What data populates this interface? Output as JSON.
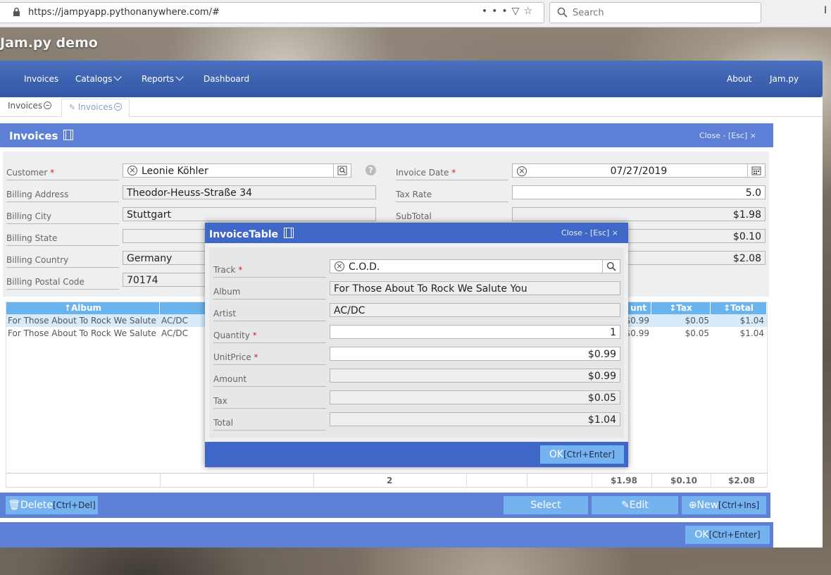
{
  "browser": {
    "url": "https://jampyapp.pythonanywhere.com/#",
    "search_placeholder": "Search",
    "right_glyph": "I"
  },
  "app": {
    "title": "Jam.py demo"
  },
  "nav": {
    "left": [
      {
        "label": "Invoices"
      },
      {
        "label": "Catalogs"
      },
      {
        "label": "Reports"
      },
      {
        "label": "Dashboard"
      }
    ],
    "right": [
      {
        "label": "About"
      },
      {
        "label": "Jam.py"
      }
    ]
  },
  "tabs": [
    {
      "label": "Invoices"
    },
    {
      "label": "Invoices"
    }
  ],
  "form": {
    "title": "Invoices",
    "close_label": "Close - [Esc] ×",
    "customer_label": "Customer",
    "customer_value": "Leonie Köhler",
    "billing_address_label": "Billing Address",
    "billing_address_value": "Theodor-Heuss-Straße 34",
    "billing_city_label": "Billing City",
    "billing_city_value": "Stuttgart",
    "billing_state_label": "Billing State",
    "billing_state_value": "",
    "billing_country_label": "Billing Country",
    "billing_country_value": "Germany",
    "billing_postal_label": "Billing Postal Code",
    "billing_postal_value": "70174",
    "invoice_date_label": "Invoice Date",
    "invoice_date_value": "07/27/2019",
    "tax_rate_label": "Tax Rate",
    "tax_rate_value": "5.0",
    "subtotal_label": "SubTotal",
    "subtotal_value": "$1.98",
    "tax_value": "$0.10",
    "total_value": "$2.08",
    "help": "?",
    "required_mark": "*"
  },
  "table": {
    "headers": {
      "album": "↑Album",
      "amount": "unt",
      "tax": "↕Tax",
      "total": "↕Total"
    },
    "rows": [
      {
        "album": "For Those About To Rock We Salute",
        "artist": "AC/DC",
        "amount": "$0.99",
        "tax": "$0.05",
        "total": "$1.04"
      },
      {
        "album": "For Those About To Rock We Salute",
        "artist": "AC/DC",
        "amount": "$0.99",
        "tax": "$0.05",
        "total": "$1.04"
      }
    ],
    "footer": {
      "quantity": "2",
      "amount": "$1.98",
      "tax": "$0.10",
      "total": "$2.08"
    }
  },
  "buttons": {
    "delete": "Delete",
    "delete_shortcut": "[Ctrl+Del]",
    "select": "Select",
    "edit": "Edit",
    "new": "New",
    "new_shortcut": "[Ctrl+Ins]",
    "ok": "OK",
    "ok_shortcut": "[Ctrl+Enter]"
  },
  "modal": {
    "title": "InvoiceTable",
    "close_label": "Close - [Esc] ×",
    "track_label": "Track",
    "track_value": "C.O.D.",
    "album_label": "Album",
    "album_value": "For Those About To Rock We Salute You",
    "artist_label": "Artist",
    "artist_value": "AC/DC",
    "quantity_label": "Quantity",
    "quantity_value": "1",
    "unitprice_label": "UnitPrice",
    "unitprice_value": "$0.99",
    "amount_label": "Amount",
    "amount_value": "$0.99",
    "tax_label": "Tax",
    "tax_value": "$0.05",
    "total_label": "Total",
    "total_value": "$1.04",
    "ok": "OK",
    "ok_shortcut": "[Ctrl+Enter]"
  }
}
